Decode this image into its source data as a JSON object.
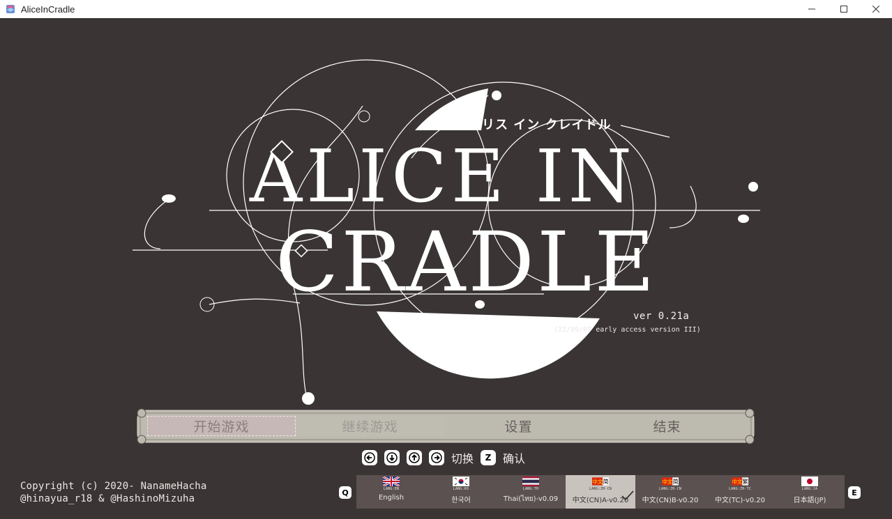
{
  "window": {
    "title": "AliceInCradle"
  },
  "logo": {
    "title_ja": "アリス イン クレイドル",
    "title_line1": "ALICE IN",
    "title_line2": "CRADLE",
    "version": "ver 0.21a",
    "version_detail": "(22/09/07 early access version III)"
  },
  "menu": {
    "items": [
      {
        "label": "开始游戏",
        "state": "selected"
      },
      {
        "label": "继续游戏",
        "state": "disabled"
      },
      {
        "label": "设置",
        "state": "normal"
      },
      {
        "label": "结束",
        "state": "normal"
      }
    ]
  },
  "hints": {
    "keys": [
      "left-arrow-key",
      "down-arrow-key",
      "up-arrow-key",
      "right-arrow-key"
    ],
    "switch_label": "切换",
    "confirm_key": "Z",
    "confirm_label": "确认"
  },
  "copyright": {
    "line1": "Copyright (c) 2020- NanameHacha",
    "line2": "@hinayua_r18 & @HashinoMizuha"
  },
  "language_bar": {
    "prev_key": "Q",
    "next_key": "E",
    "languages": [
      {
        "code": "LANG:EN",
        "label": "English",
        "flag": "uk-flag-icon",
        "selected": false
      },
      {
        "code": "LANG:KO",
        "label": "한국어",
        "flag": "korea-flag-icon",
        "selected": false
      },
      {
        "code": "LANG:TH",
        "label": "Thai(ไทย)-v0.09",
        "flag": "thailand-flag-icon",
        "selected": false
      },
      {
        "code": "LANG:ZH-CN",
        "label": "中文(CN)A-v0.20",
        "flag": "zh-simplified-icon",
        "badge": "中文",
        "badge2": "简",
        "selected": true
      },
      {
        "code": "LANG:ZH-CN",
        "label": "中文(CN)B-v0.20",
        "flag": "zh-simplified-icon",
        "badge": "中文",
        "badge2": "简",
        "selected": false
      },
      {
        "code": "LANG:ZH-TC",
        "label": "中文(TC)-v0.20",
        "flag": "zh-traditional-icon",
        "badge": "中文",
        "badge2": "繁",
        "selected": false
      },
      {
        "code": "LANG:JA",
        "label": "日本語(JP)",
        "flag": "japan-flag-icon",
        "selected": false
      }
    ]
  },
  "colors": {
    "background": "#3a3434",
    "menu_bar": "#bfbcb2",
    "selected_item": "#c7b8b8",
    "lang_bar": "#5a5150",
    "lang_selected": "#c9c3bd",
    "logo_white": "#ffffff"
  }
}
